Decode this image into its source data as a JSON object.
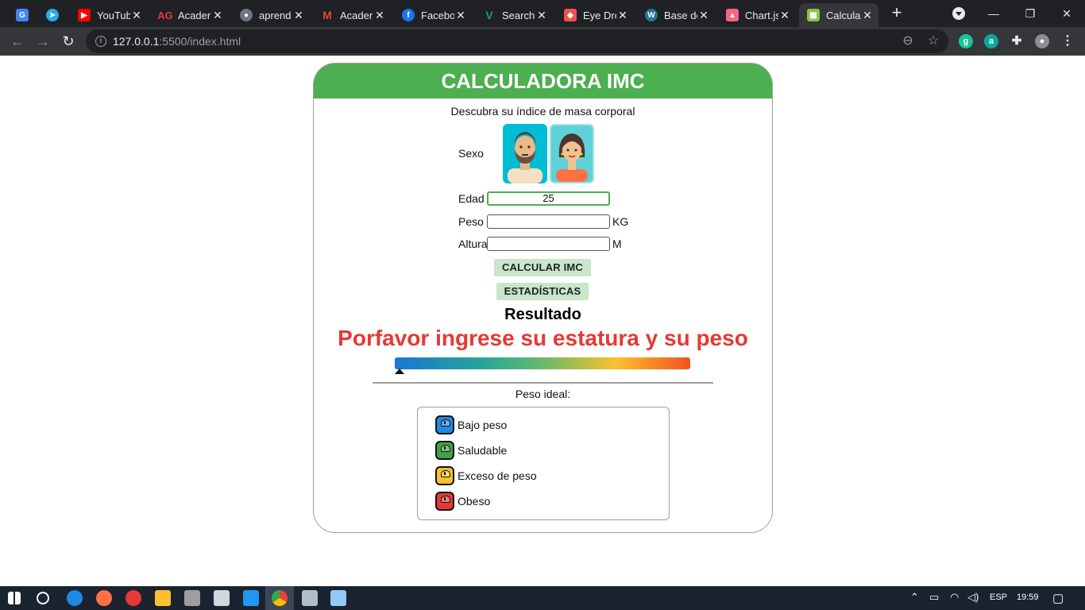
{
  "browser": {
    "tabs": [
      {
        "label": "",
        "favicon": "google-translate-icon",
        "color": "#4285f4"
      },
      {
        "label": "",
        "favicon": "telegram-icon",
        "color": "#2aabee"
      },
      {
        "label": "YouTub",
        "favicon": "youtube-icon",
        "color": "#ff0000"
      },
      {
        "label": "Acader",
        "favicon": "ag-icon",
        "color": "#e53935"
      },
      {
        "label": "aprend",
        "favicon": "github-icon",
        "color": "#6e7681"
      },
      {
        "label": "Acader",
        "favicon": "gmail-icon",
        "color": "#ea4335"
      },
      {
        "label": "Facebo",
        "favicon": "facebook-icon",
        "color": "#1877f2"
      },
      {
        "label": "Search",
        "favicon": "vuetify-icon",
        "color": "#1aa260"
      },
      {
        "label": "Eye Dro",
        "favicon": "eyedropper-icon",
        "color": "#ef5350"
      },
      {
        "label": "Base de",
        "favicon": "wordpress-icon",
        "color": "#21759b"
      },
      {
        "label": "Chart.js",
        "favicon": "chartjs-icon",
        "color": "#ff6384"
      },
      {
        "label": "Calcula",
        "favicon": "calculator-icon",
        "color": "#8bc34a"
      }
    ],
    "active_tab_index": 11,
    "url_host": "127.0.0.1",
    "url_rest": ":5500/index.html"
  },
  "page": {
    "title": "CALCULADORA IMC",
    "subtitle": "Descubra su índice de masa corporal",
    "sex_label": "Sexo",
    "age_label": "Edad",
    "age_value": "25",
    "weight_label": "Peso",
    "weight_value": "",
    "weight_unit": "KG",
    "height_label": "Altura",
    "height_value": "",
    "height_unit": "M",
    "calc_button": "CALCULAR IMC",
    "stats_button": "ESTADÍSTICAS",
    "result_title": "Resultado",
    "result_message": "Porfavor ingrese su estatura y su peso",
    "ideal_weight_label": "Peso ideal:",
    "legend": [
      {
        "label": "Bajo peso",
        "color": "#1e88e5"
      },
      {
        "label": "Saludable",
        "color": "#43a047"
      },
      {
        "label": "Exceso de peso",
        "color": "#fbc02d"
      },
      {
        "label": "Obeso",
        "color": "#e53935"
      }
    ],
    "accent_color": "#4caf50"
  },
  "taskbar": {
    "language": "ESP",
    "time": "19:59"
  }
}
